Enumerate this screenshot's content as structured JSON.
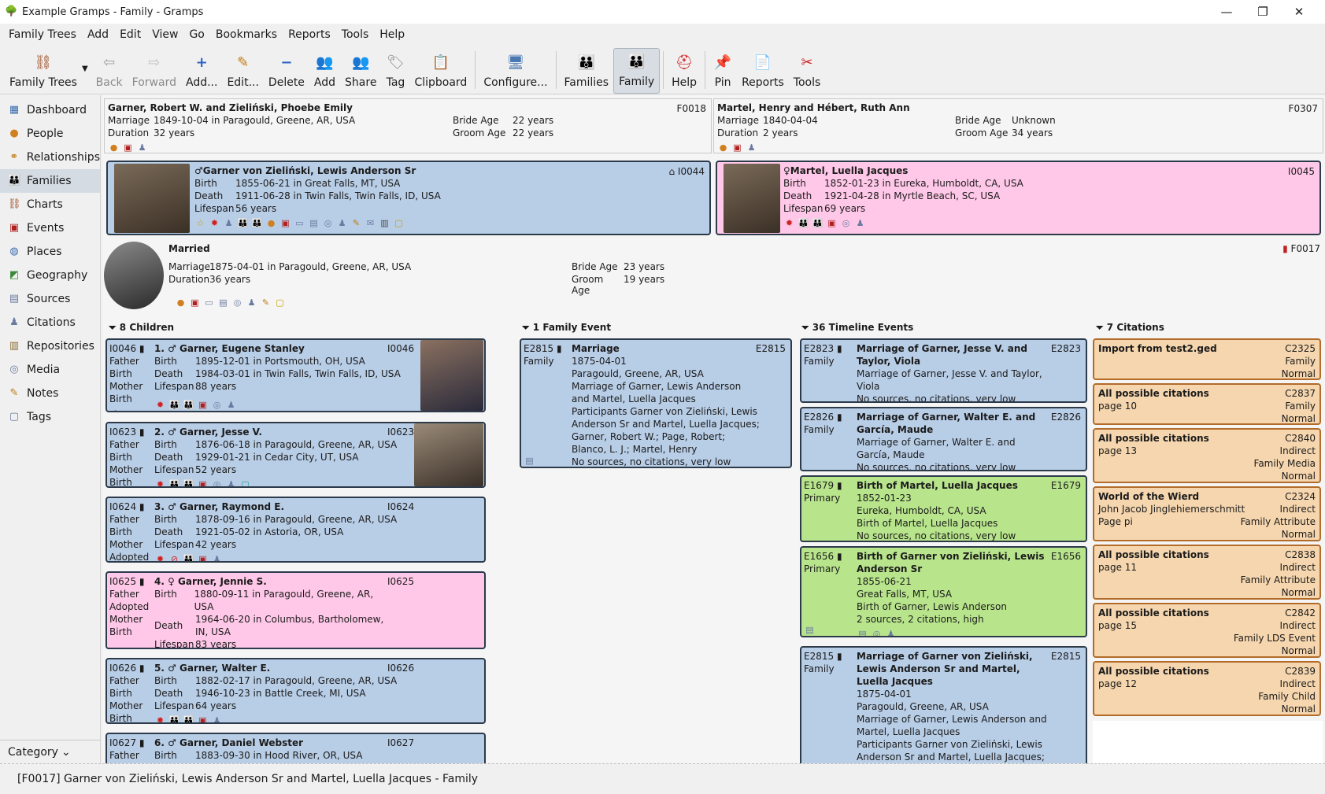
{
  "window": {
    "title": "Example Gramps - Family - Gramps"
  },
  "menu": [
    "Family Trees",
    "Add",
    "Edit",
    "View",
    "Go",
    "Bookmarks",
    "Reports",
    "Tools",
    "Help"
  ],
  "toolbar": {
    "family_trees": "Family Trees",
    "back": "Back",
    "forward": "Forward",
    "add_dots": "Add...",
    "edit_dots": "Edit...",
    "delete": "Delete",
    "add": "Add",
    "share": "Share",
    "tag": "Tag",
    "clipboard": "Clipboard",
    "configure": "Configure...",
    "families": "Families",
    "family": "Family",
    "help": "Help",
    "pin": "Pin",
    "reports": "Reports",
    "tools": "Tools"
  },
  "sidebar": {
    "items": [
      "Dashboard",
      "People",
      "Relationships",
      "Families",
      "Charts",
      "Events",
      "Places",
      "Geography",
      "Sources",
      "Citations",
      "Repositories",
      "Media",
      "Notes",
      "Tags"
    ],
    "category": "Category"
  },
  "parents_left": {
    "title": "Garner, Robert W. and Zieliński, Phoebe Emily",
    "id": "F0018",
    "marriage_lbl": "Marriage",
    "marriage": "1849-10-04 in Paragould, Greene, AR, USA",
    "duration_lbl": "Duration",
    "duration": "32 years",
    "bride_lbl": "Bride Age",
    "bride": "22 years",
    "groom_lbl": "Groom Age",
    "groom": "22 years"
  },
  "parents_right": {
    "title": "Martel, Henry and Hébert, Ruth Ann",
    "id": "F0307",
    "marriage_lbl": "Marriage",
    "marriage": "1840-04-04",
    "duration_lbl": "Duration",
    "duration": "2 years",
    "bride_lbl": "Bride Age",
    "bride": "Unknown",
    "groom_lbl": "Groom Age",
    "groom": "34 years"
  },
  "father": {
    "name": "♂Garner von Zieliński, Lewis Anderson Sr",
    "id": "I0044",
    "birth_lbl": "Birth",
    "birth": "1855-06-21 in Great Falls, MT, USA",
    "death_lbl": "Death",
    "death": "1911-06-28 in Twin Falls, Twin Falls, ID, USA",
    "lifespan_lbl": "Lifespan",
    "lifespan": "56 years"
  },
  "mother": {
    "name": "♀Martel, Luella Jacques",
    "id": "I0045",
    "birth_lbl": "Birth",
    "birth": "1852-01-23 in Eureka, Humboldt, CA, USA",
    "death_lbl": "Death",
    "death": "1921-04-28 in Myrtle Beach, SC, USA",
    "lifespan_lbl": "Lifespan",
    "lifespan": "69 years"
  },
  "family": {
    "status": "Married",
    "id": "F0017",
    "marriage_lbl": "Marriage",
    "marriage": "1875-04-01 in Paragould, Greene, AR, USA",
    "duration_lbl": "Duration",
    "duration": "36 years",
    "bride_lbl": "Bride Age",
    "bride": "23 years",
    "groom_lbl": "Groom Age",
    "groom": "19 years"
  },
  "sections": {
    "children": "8 Children",
    "events": "1 Family Event",
    "timeline": "36 Timeline Events",
    "citations": "7 Citations"
  },
  "children": [
    {
      "id": "I0046",
      "rel": [
        "Father",
        "Birth",
        "Mother",
        "Birth"
      ],
      "name": "1. ♂ Garner, Eugene Stanley",
      "birth": "1895-12-01 in Portsmouth, OH, USA",
      "death": "1984-03-01 in Twin Falls, Twin Falls, ID, USA",
      "lifespan": "88 years"
    },
    {
      "id": "I0623",
      "rel": [
        "Father",
        "Birth",
        "Mother",
        "Birth"
      ],
      "name": "2. ♂ Garner, Jesse V.",
      "birth": "1876-06-18 in Paragould, Greene, AR, USA",
      "death": "1929-01-21 in Cedar City, UT, USA",
      "lifespan": "52 years"
    },
    {
      "id": "I0624",
      "rel": [
        "Father",
        "Birth",
        "Mother",
        "Adopted"
      ],
      "name": "3. ♂ Garner, Raymond E.",
      "birth": "1878-09-16 in Paragould, Greene, AR, USA",
      "death": "1921-05-02 in Astoria, OR, USA",
      "lifespan": "42 years"
    },
    {
      "id": "I0625",
      "rel": [
        "Father",
        "Adopted",
        "Mother",
        "Birth"
      ],
      "name": "4. ♀ Garner, Jennie S.",
      "birth": "1880-09-11 in Paragould, Greene, AR, USA",
      "death": "1964-06-20 in Columbus, Bartholomew, IN, USA",
      "lifespan": "83 years"
    },
    {
      "id": "I0626",
      "rel": [
        "Father",
        "Birth",
        "Mother",
        "Birth"
      ],
      "name": "5. ♂ Garner, Walter E.",
      "birth": "1882-02-17 in Paragould, Greene, AR, USA",
      "death": "1946-10-23 in Battle Creek, MI, USA",
      "lifespan": "64 years"
    },
    {
      "id": "I0627",
      "rel": [
        "Father"
      ],
      "name": "6. ♂ Garner, Daniel Webster",
      "birth": "1883-09-30 in Hood River, OR, USA"
    }
  ],
  "labels": {
    "birth": "Birth",
    "death": "Death",
    "lifespan": "Lifespan"
  },
  "family_event": {
    "id": "E2815",
    "role": "Family",
    "type": "Marriage",
    "date": "1875-04-01",
    "place": "Paragould, Greene, AR, USA",
    "desc": "Marriage of Garner, Lewis Anderson and Martel, Luella Jacques",
    "participants": "Participants Garner von Zieliński, Lewis Anderson Sr and Martel, Luella Jacques; Garner, Robert W.; Page, Robert; Blanco, L. J.; Martel, Henry",
    "quality": "No sources, no citations, very low"
  },
  "timeline": [
    {
      "id": "E2823",
      "role": "Family",
      "title": "Marriage of Garner, Jesse V. and Taylor, Viola",
      "lines": [
        "Marriage of Garner, Jesse V. and Taylor, Viola",
        "No sources, no citations, very low"
      ]
    },
    {
      "id": "E2826",
      "role": "Family",
      "title": "Marriage of Garner, Walter E. and García, Maude",
      "lines": [
        "Marriage of Garner, Walter E. and García, Maude",
        "No sources, no citations, very low"
      ]
    },
    {
      "id": "E1679",
      "role": "Primary",
      "title": "Birth of Martel, Luella Jacques",
      "lines": [
        "1852-01-23",
        "Eureka, Humboldt, CA, USA",
        "Birth of Martel, Luella Jacques",
        "No sources, no citations, very low"
      ]
    },
    {
      "id": "E1656",
      "role": "Primary",
      "title": "Birth of Garner von Zieliński, Lewis Anderson Sr",
      "lines": [
        "1855-06-21",
        "Great Falls, MT, USA",
        "Birth of Garner, Lewis Anderson",
        "2 sources, 2 citations, high"
      ]
    },
    {
      "id": "E2815",
      "role": "Family",
      "title": "Marriage of Garner von Zieliński, Lewis Anderson Sr and Martel, Luella Jacques",
      "lines": [
        "1875-04-01",
        "Paragould, Greene, AR, USA",
        "Marriage of Garner, Lewis Anderson and Martel, Luella Jacques",
        "Participants Garner von Zieliński, Lewis Anderson Sr and Martel, Luella Jacques; Garner, Robert W.; Page, Robert; Blanco, L."
      ]
    }
  ],
  "citations": [
    {
      "id": "C2325",
      "title": "Import from test2.ged",
      "sub": "",
      "type": "Family",
      "extra": "",
      "conf": "Normal"
    },
    {
      "id": "C2837",
      "title": "All possible citations",
      "sub": "page 10",
      "type": "Family",
      "extra": "",
      "conf": "Normal"
    },
    {
      "id": "C2840",
      "title": "All possible citations",
      "sub": "page 13",
      "type": "Indirect",
      "extra": "Family Media",
      "conf": "Normal"
    },
    {
      "id": "C2324",
      "title": "World of the Wierd",
      "sub": "John Jacob Jinglehiemerschmitt",
      "type": "Indirect",
      "extra": "Family Attribute",
      "sub2": "Page pi",
      "conf": "Normal"
    },
    {
      "id": "C2838",
      "title": "All possible citations",
      "sub": "page 11",
      "type": "Indirect",
      "extra": "Family Attribute",
      "conf": "Normal"
    },
    {
      "id": "C2842",
      "title": "All possible citations",
      "sub": "page 15",
      "type": "Indirect",
      "extra": "Family LDS Event",
      "conf": "Normal"
    },
    {
      "id": "C2839",
      "title": "All possible citations",
      "sub": "page 12",
      "type": "Indirect",
      "extra": "Family Child",
      "conf": "Normal"
    }
  ],
  "status": "[F0017] Garner von Zieliński, Lewis Anderson Sr and Martel, Luella Jacques - Family"
}
